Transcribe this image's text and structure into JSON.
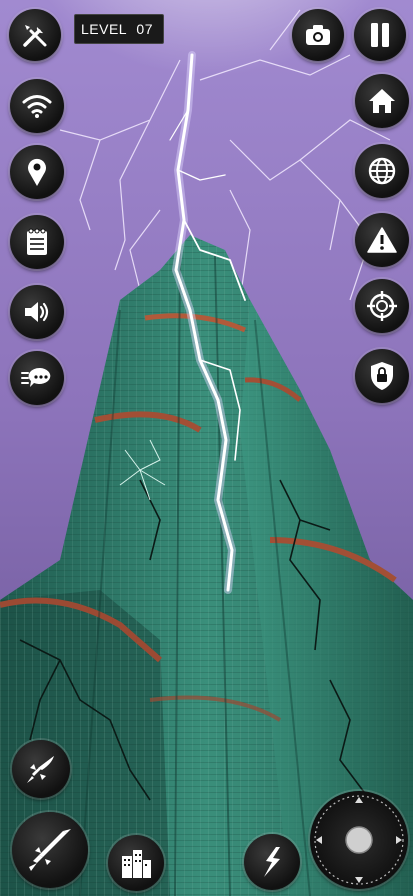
{
  "hud": {
    "level_label": "LEVEL",
    "level_number": "07"
  },
  "icons": {
    "top_left": "tools-icon",
    "top_right_1": "camera-icon",
    "top_right_2": "pause-icon",
    "left": [
      "wifi-icon",
      "location-pin-icon",
      "notepad-icon",
      "speaker-icon",
      "chat-icon"
    ],
    "right": [
      "home-icon",
      "globe-icon",
      "warning-icon",
      "crosshair-icon",
      "shield-lock-icon"
    ],
    "bottom": [
      "rocket-icon",
      "missile-icon",
      "building-icon",
      "lightning-icon",
      "joystick"
    ]
  },
  "colors": {
    "sky": "#8c73b8",
    "tower": "#2e7a6a",
    "lightning": "#ffffff",
    "button": "#1c1c1c"
  }
}
